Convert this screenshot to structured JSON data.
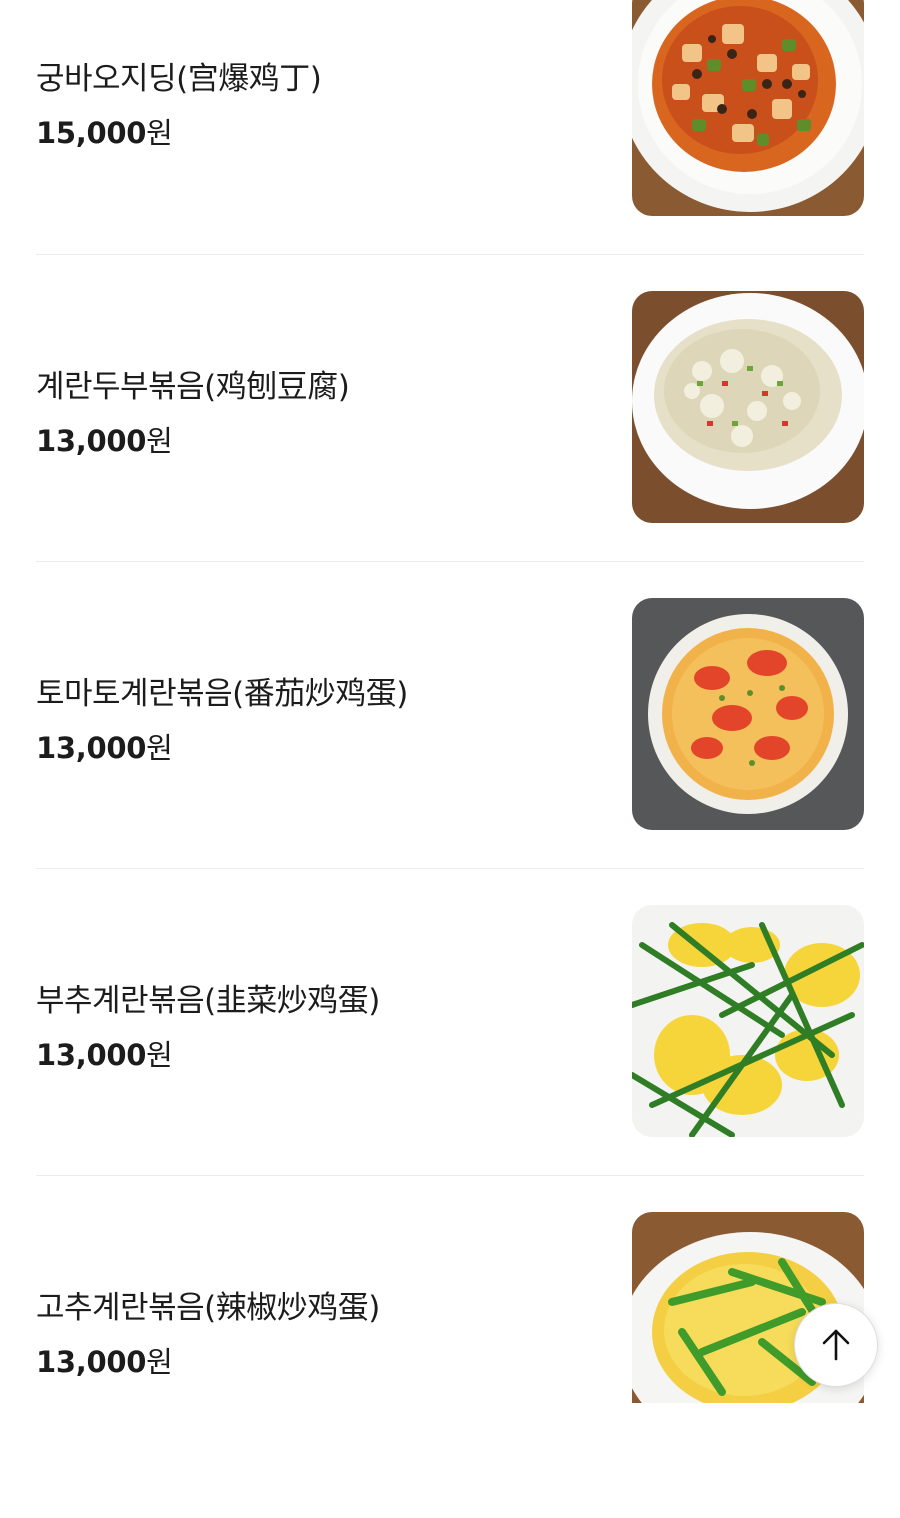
{
  "menu": {
    "items": [
      {
        "name": "궁바오지딩(宫爆鸡丁)",
        "price_number": "15,000",
        "price_unit": "원",
        "image": "kung-pao-chicken-photo"
      },
      {
        "name": "계란두부볶음(鸡刨豆腐)",
        "price_number": "13,000",
        "price_unit": "원",
        "image": "egg-tofu-stirfry-photo"
      },
      {
        "name": "토마토계란볶음(番茄炒鸡蛋)",
        "price_number": "13,000",
        "price_unit": "원",
        "image": "tomato-egg-stirfry-photo"
      },
      {
        "name": "부추계란볶음(韭菜炒鸡蛋)",
        "price_number": "13,000",
        "price_unit": "원",
        "image": "chive-egg-stirfry-photo"
      },
      {
        "name": "고추계란볶음(辣椒炒鸡蛋)",
        "price_number": "13,000",
        "price_unit": "원",
        "image": "pepper-egg-stirfry-photo"
      }
    ]
  },
  "scroll_top": {
    "icon": "arrow-up-icon"
  }
}
